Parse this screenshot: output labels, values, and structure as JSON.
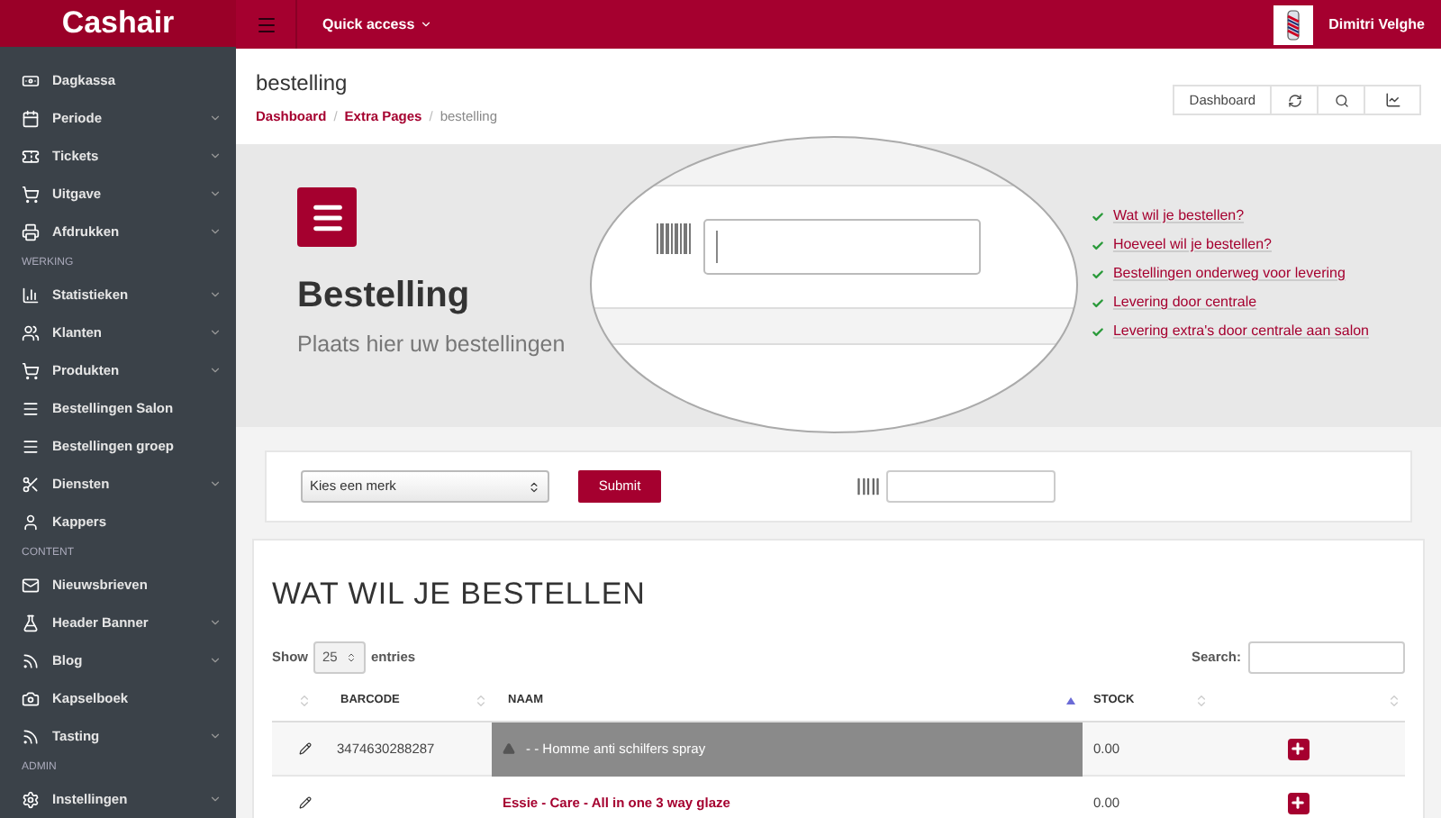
{
  "brand": "Cashair",
  "topbar": {
    "quick_access": "Quick access",
    "user_name": "Dimitri Velghe"
  },
  "sidebar": {
    "items": [
      {
        "kind": "item",
        "label": "Dagkassa",
        "caret": false
      },
      {
        "kind": "item",
        "label": "Periode",
        "caret": true
      },
      {
        "kind": "item",
        "label": "Tickets",
        "caret": true
      },
      {
        "kind": "item",
        "label": "Uitgave",
        "caret": true
      },
      {
        "kind": "item",
        "label": "Afdrukken",
        "caret": true
      },
      {
        "kind": "section",
        "label": "WERKING"
      },
      {
        "kind": "item",
        "label": "Statistieken",
        "caret": true
      },
      {
        "kind": "item",
        "label": "Klanten",
        "caret": true
      },
      {
        "kind": "item",
        "label": "Produkten",
        "caret": true
      },
      {
        "kind": "item",
        "label": "Bestellingen Salon",
        "caret": false
      },
      {
        "kind": "item",
        "label": "Bestellingen groep",
        "caret": false
      },
      {
        "kind": "item",
        "label": "Diensten",
        "caret": true
      },
      {
        "kind": "item",
        "label": "Kappers",
        "caret": false
      },
      {
        "kind": "section",
        "label": "CONTENT"
      },
      {
        "kind": "item",
        "label": "Nieuwsbrieven",
        "caret": false
      },
      {
        "kind": "item",
        "label": "Header Banner",
        "caret": true
      },
      {
        "kind": "item",
        "label": "Blog",
        "caret": true
      },
      {
        "kind": "item",
        "label": "Kapselboek",
        "caret": false
      },
      {
        "kind": "item",
        "label": "Tasting",
        "caret": true
      },
      {
        "kind": "section",
        "label": "ADMIN"
      },
      {
        "kind": "item",
        "label": "Instellingen",
        "caret": true
      }
    ]
  },
  "page_header": {
    "title": "bestelling",
    "breadcrumb": [
      "Dashboard",
      "Extra Pages",
      "bestelling"
    ],
    "separator": "/",
    "dashboard_button": "Dashboard"
  },
  "hero": {
    "title": "Bestelling",
    "subtitle": "Plaats hier uw bestellingen",
    "checklist": [
      "Wat wil je bestellen?",
      "Hoeveel wil je bestellen?",
      "Bestellingen onderweg voor levering",
      "Levering door centrale",
      "Levering extra's door centrale aan salon"
    ]
  },
  "form": {
    "brand_select": "Kies een merk",
    "submit": "Submit"
  },
  "table": {
    "title": "WAT WIL JE BESTELLEN",
    "show": "Show",
    "entries_value": "25",
    "entries": "entries",
    "search_label": "Search:",
    "columns": [
      "BARCODE",
      "NAAM",
      "STOCK"
    ],
    "rows": [
      {
        "barcode": "3474630288287",
        "naam": "- - Homme anti schilfers spray",
        "stock": "0.00",
        "highlighted": true
      },
      {
        "naam": "Essie - Care - All in one 3 way glaze",
        "stock": "0.00",
        "highlighted": false
      }
    ]
  }
}
